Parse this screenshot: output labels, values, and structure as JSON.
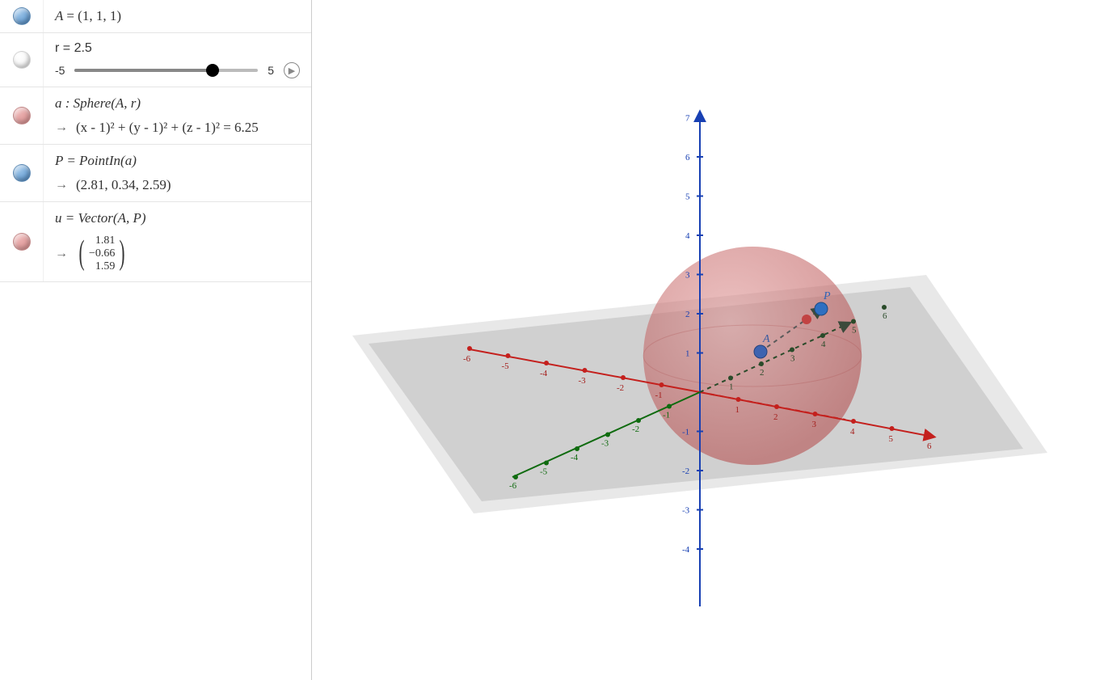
{
  "algebra": {
    "point_A": {
      "label": "A",
      "coords_text": "(1, 1, 1)"
    },
    "slider_r": {
      "name": "r",
      "value_text": "2.5",
      "min_label": "-5",
      "max_label": "5",
      "value_pct": 75
    },
    "sphere_a": {
      "definition_text": "a : Sphere(A, r)",
      "result_text": "(x - 1)²  +  (y - 1)²  +  (z - 1)²  =  6.25"
    },
    "point_P": {
      "definition_text": "P  =  PointIn(a)",
      "result_text": "(2.81, 0.34, 2.59)"
    },
    "vector_u": {
      "definition_text": "u  =  Vector(A, P)",
      "components": [
        "1.81",
        "−0.66",
        "1.59"
      ]
    }
  },
  "view3d": {
    "axis_z": {
      "ticks_pos": [
        "7",
        "6",
        "5",
        "4",
        "3",
        "2",
        "1"
      ],
      "ticks_neg": [
        "-1",
        "-2",
        "-3",
        "-4"
      ]
    },
    "axis_x": {
      "ticks_pos": [
        "1",
        "2",
        "3",
        "4",
        "5",
        "6"
      ],
      "ticks_neg": [
        "-1",
        "-2",
        "-3",
        "-4",
        "-5",
        "-6"
      ]
    },
    "axis_y": {
      "ticks_pos": [
        "1",
        "2",
        "3",
        "4",
        "5",
        "6"
      ],
      "ticks_neg": [
        "-1",
        "-2",
        "-3",
        "-4",
        "-5",
        "-6"
      ]
    },
    "point_labels": {
      "A": "A",
      "P": "P"
    }
  }
}
